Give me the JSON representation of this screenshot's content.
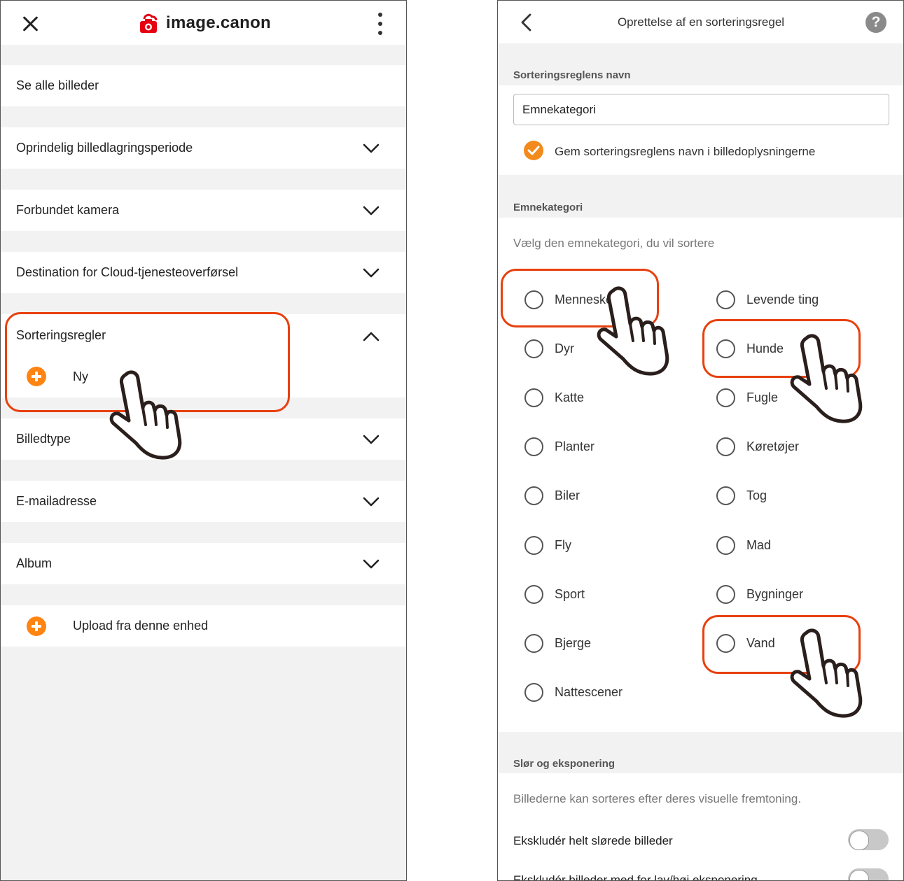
{
  "left": {
    "brand": "image.canon",
    "items": [
      {
        "label": "Se alle billeder"
      },
      {
        "label": "Oprindelig billedlagringsperiode"
      },
      {
        "label": "Forbundet kamera"
      },
      {
        "label": "Destination for Cloud-tjenesteoverførsel"
      },
      {
        "label": "Sorteringsregler"
      },
      {
        "label": "Billedtype"
      },
      {
        "label": "E-mailadresse"
      },
      {
        "label": "Album"
      }
    ],
    "new_label": "Ny",
    "upload_label": "Upload fra denne enhed"
  },
  "right": {
    "title": "Oprettelse af en sorteringsregel",
    "help": "?",
    "name_section": "Sorteringsreglens navn",
    "name_value": "Emnekategori",
    "save_name_label": "Gem sorteringsreglens navn i billedoplysningerne",
    "category_section": "Emnekategori",
    "category_hint": "Vælg den emnekategori, du vil sortere",
    "categories_left": [
      "Mennesker",
      "Dyr",
      "Katte",
      "Planter",
      "Biler",
      "Fly",
      "Sport",
      "Bjerge",
      "Nattescener"
    ],
    "categories_right": [
      "Levende ting",
      "Hunde",
      "Fugle",
      "Køretøjer",
      "Tog",
      "Mad",
      "Bygninger",
      "Vand"
    ],
    "blur_section": "Slør og eksponering",
    "blur_hint": "Billederne kan sorteres efter deres visuelle fremtoning.",
    "toggle1_label": "Ekskludér helt slørede billeder",
    "toggle2_label": "Ekskludér billeder med for lav/høj eksponering"
  },
  "colors": {
    "accent": "#ff8412",
    "highlight": "#e8400e",
    "brand_red": "#e60012"
  }
}
